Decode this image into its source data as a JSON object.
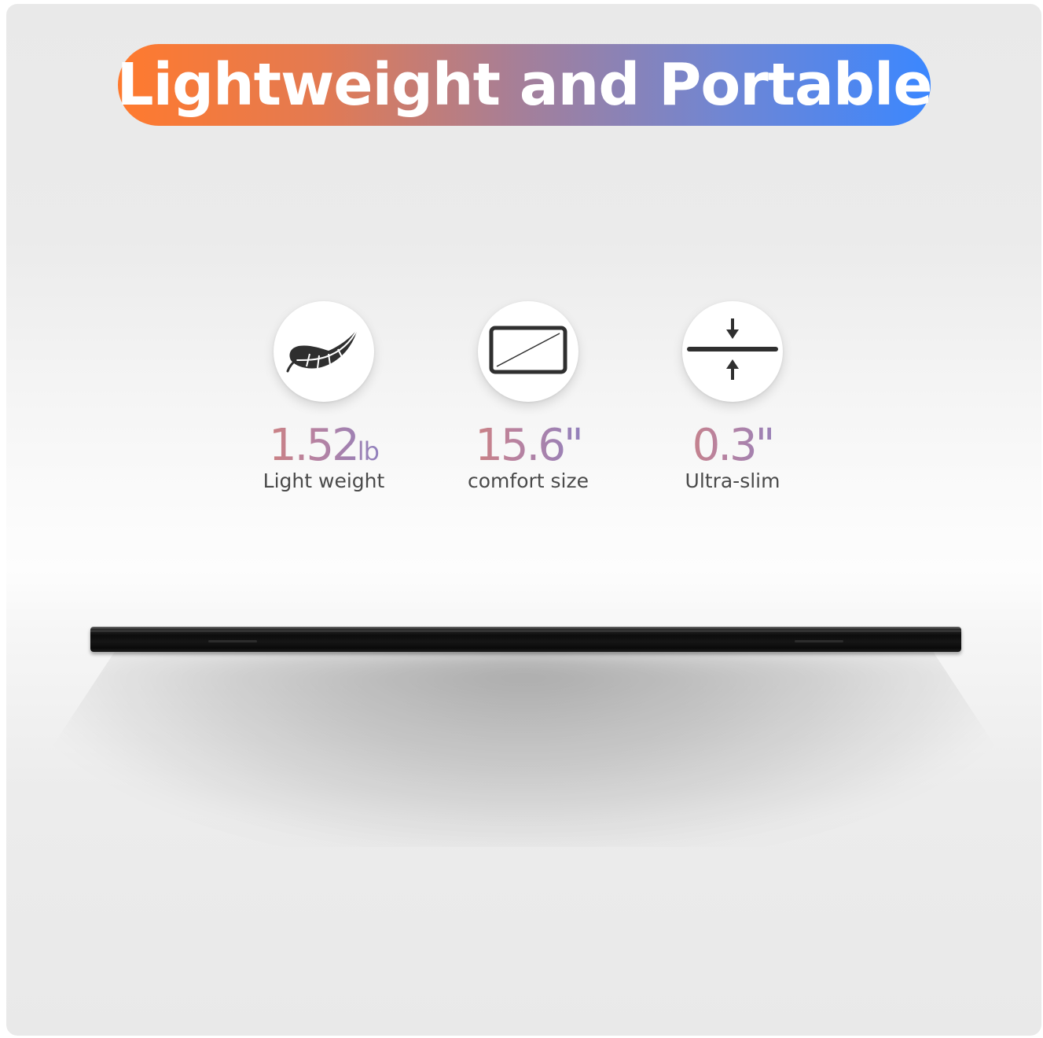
{
  "title": "Lightweight and Portable",
  "colors": {
    "title_gradient_start": "#ff7a2e",
    "title_gradient_end": "#3b87ff",
    "value_gradient_start": "#e88058",
    "value_gradient_end": "#6c7fd8"
  },
  "features": [
    {
      "icon": "feather-icon",
      "value": "1.52",
      "unit": "lb",
      "label": "Light weight"
    },
    {
      "icon": "screen-diagonal-icon",
      "value": "15.6\"",
      "unit": "",
      "label": "comfort size"
    },
    {
      "icon": "thickness-arrows-icon",
      "value": "0.3\"",
      "unit": "",
      "label": "Ultra-slim"
    }
  ]
}
